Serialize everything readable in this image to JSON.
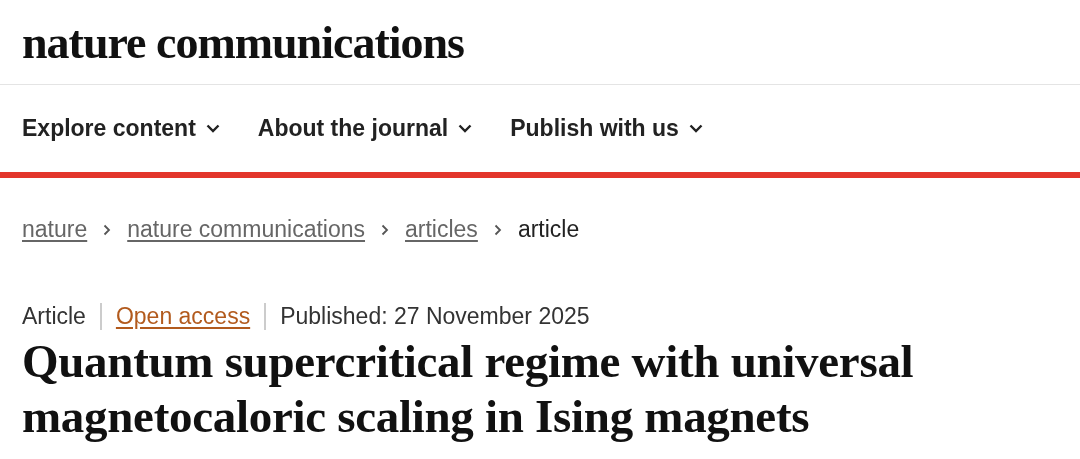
{
  "logo": "nature communications",
  "nav": [
    {
      "label": "Explore content",
      "expanded": false
    },
    {
      "label": "About the journal",
      "expanded": false
    },
    {
      "label": "Publish with us",
      "expanded": false
    }
  ],
  "breadcrumbs": [
    {
      "label": "nature",
      "kind": "link"
    },
    {
      "label": "nature communications",
      "kind": "link"
    },
    {
      "label": "articles",
      "kind": "link"
    },
    {
      "label": "article",
      "kind": "current"
    }
  ],
  "meta": {
    "type": "Article",
    "access": "Open access",
    "published": "Published: 27 November 2025"
  },
  "title": "Quantum supercritical regime with universal magnetocaloric scaling in Ising magnets"
}
